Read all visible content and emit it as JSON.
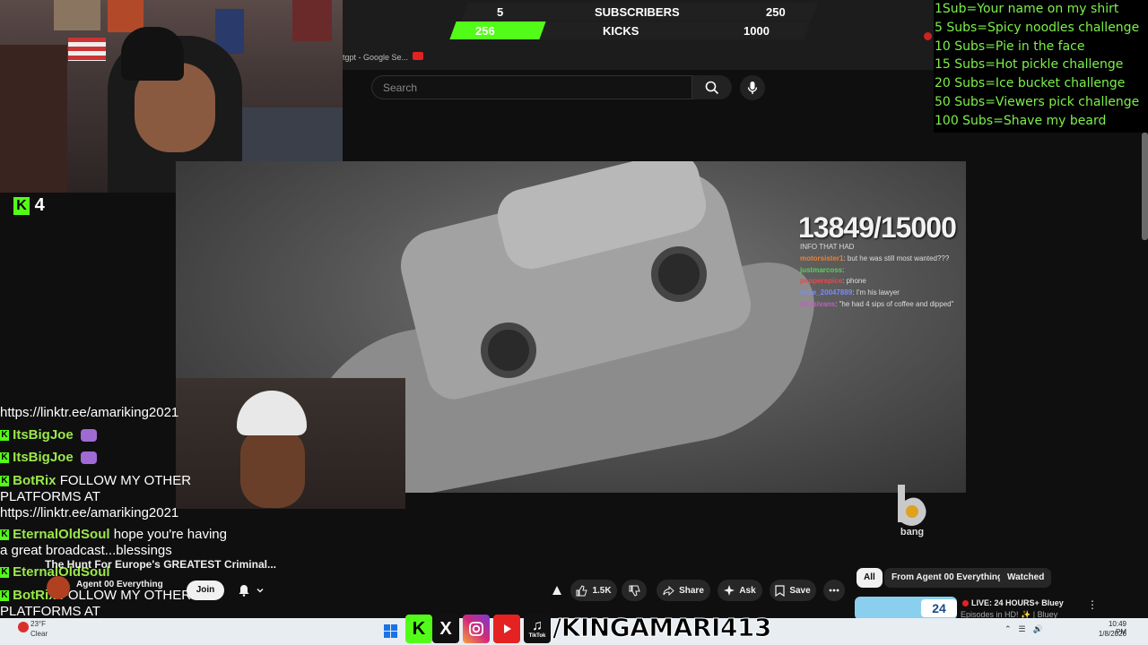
{
  "browser": {
    "tab_title": "tgpt - Google Se...",
    "search_placeholder": "Search"
  },
  "banner": {
    "subscribers_current": "5",
    "subscribers_label": "SUBSCRIBERS",
    "subscribers_goal": "250",
    "kicks_current": "256",
    "kicks_label": "KICKS",
    "kicks_goal": "1000"
  },
  "goals": [
    "1Sub=Your name on my shirt",
    "5 Subs=Spicy noodles challenge",
    "10 Subs=Pie in the face",
    "15 Subs=Hot pickle challenge",
    "20 Subs=Ice bucket challenge",
    "50 Subs=Viewers pick challenge",
    "100 Subs=Shave my beard"
  ],
  "kick_viewers": "4",
  "video_overlay": {
    "counter": "13849/15000",
    "chat": [
      {
        "user": "",
        "text": "INFO THAT HAD"
      },
      {
        "user": "motorsister1",
        "text": ": but he was still most wanted???"
      },
      {
        "user": "justmarcoss",
        "text": ":"
      },
      {
        "user": "pepperspice",
        "text": ": phone"
      },
      {
        "user": "mike_20047889",
        "text": ": I'm his lawyer"
      },
      {
        "user": "ettysivans",
        "text": ": \"he had 4 sips of coffee and dipped\""
      }
    ]
  },
  "chat": [
    {
      "user": "",
      "text": "https://linktr.ee/amariking2021"
    },
    {
      "user": "ItsBigJoe",
      "text": ""
    },
    {
      "user": "ItsBigJoe",
      "text": ""
    },
    {
      "user": "BotRix",
      "text": "FOLLOW MY OTHER PLATFORMS AT https://linktr.ee/amariking2021"
    },
    {
      "user": "EternalOldSoul",
      "text": "hope you're having a great broadcast...blessings"
    },
    {
      "user": "EternalOldSoul",
      "text": ""
    },
    {
      "user": "BotRix",
      "text": "FOLLOW MY OTHER PLATFORMS AT https://linktr.ee/amariking2021"
    }
  ],
  "video": {
    "title": "The Hunt For Europe's GREATEST Criminal...",
    "channel": "Agent 00 Everything",
    "join_label": "Join",
    "likes": "1.5K",
    "share_label": "Share",
    "ask_label": "Ask",
    "save_label": "Save"
  },
  "watermark": "bang",
  "chips": [
    "All",
    "From Agent 00 Everything",
    "Watched"
  ],
  "recommendation": {
    "title": "LIVE: 24 HOURS+ Bluey",
    "subtitle": "Episodes in HD! ✨ | Bluey",
    "badge": "24"
  },
  "socials": {
    "handle": "/KINGAMARI413",
    "tiktok_label": "TikTok"
  },
  "taskbar": {
    "weather_temp": "23°F",
    "weather_desc": "Clear",
    "time": "10:49 PM",
    "date": "1/8/2026"
  },
  "colors": {
    "kick_green": "#53fc18",
    "goals_green": "#7cf04a",
    "chat_user": "#9be84a"
  }
}
